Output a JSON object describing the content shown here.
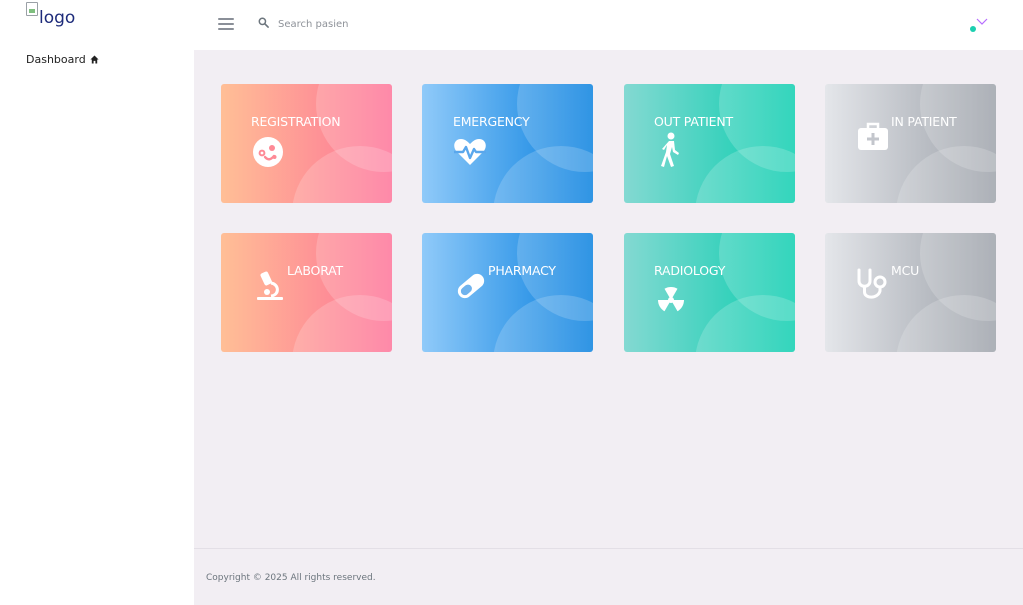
{
  "sidebar": {
    "logo_alt": "logo",
    "items": [
      {
        "label": "Dashboard",
        "icon": "home-icon"
      }
    ]
  },
  "topbar": {
    "search_placeholder": "Search pasien"
  },
  "cards": [
    {
      "label": "REGISTRATION",
      "icon": "patient-face-icon",
      "color": "#fe7096"
    },
    {
      "label": "EMERGENCY",
      "icon": "heartbeat-icon",
      "color": "#047edf"
    },
    {
      "label": "OUT PATIENT",
      "icon": "walking-person-icon",
      "color": "#07cdae"
    },
    {
      "label": "IN PATIENT",
      "icon": "medical-kit-icon",
      "color": "#9ba0a8"
    },
    {
      "label": "LABORAT",
      "icon": "microscope-icon",
      "color": "#fe7096"
    },
    {
      "label": "PHARMACY",
      "icon": "pill-icon",
      "color": "#047edf"
    },
    {
      "label": "RADIOLOGY",
      "icon": "radiation-icon",
      "color": "#07cdae"
    },
    {
      "label": "MCU",
      "icon": "stethoscope-icon",
      "color": "#9ba0a8"
    }
  ],
  "footer": {
    "text": "Copyright © 2025 All rights reserved."
  },
  "colors": {
    "main_bg": "#f2eef3",
    "accent_dot": "#1ccfb0",
    "chevron": "#b66dff"
  }
}
